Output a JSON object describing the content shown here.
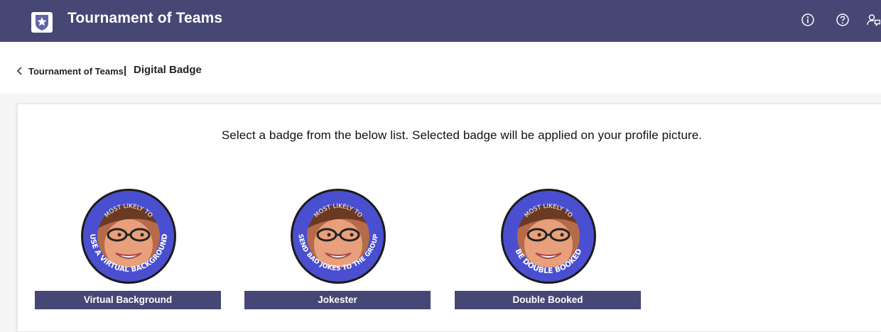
{
  "header": {
    "app_title": "Tournament of Teams",
    "icons": [
      "info-icon",
      "help-icon",
      "feedback-icon"
    ],
    "background_color": "#464775"
  },
  "breadcrumb": {
    "parent": "Tournament of Teams",
    "separator": "|",
    "current": "Digital Badge"
  },
  "main": {
    "instructions": "Select a badge from the below list. Selected badge will be applied on your profile picture.",
    "badges": [
      {
        "label": "Virtual Background",
        "ring_top": "MOST LIKELY TO",
        "ring_bottom": "USE A VIRTUAL BACKGROUND"
      },
      {
        "label": "Jokester",
        "ring_top": "MOST LIKELY TO",
        "ring_bottom": "SEND BAD JOKES TO THE GROUP"
      },
      {
        "label": "Double Booked",
        "ring_top": "MOST LIKELY TO",
        "ring_bottom": "BE DOUBLE BOOKED"
      }
    ]
  },
  "colors": {
    "accent": "#464775",
    "badge_ring": "#4a4fd0"
  }
}
